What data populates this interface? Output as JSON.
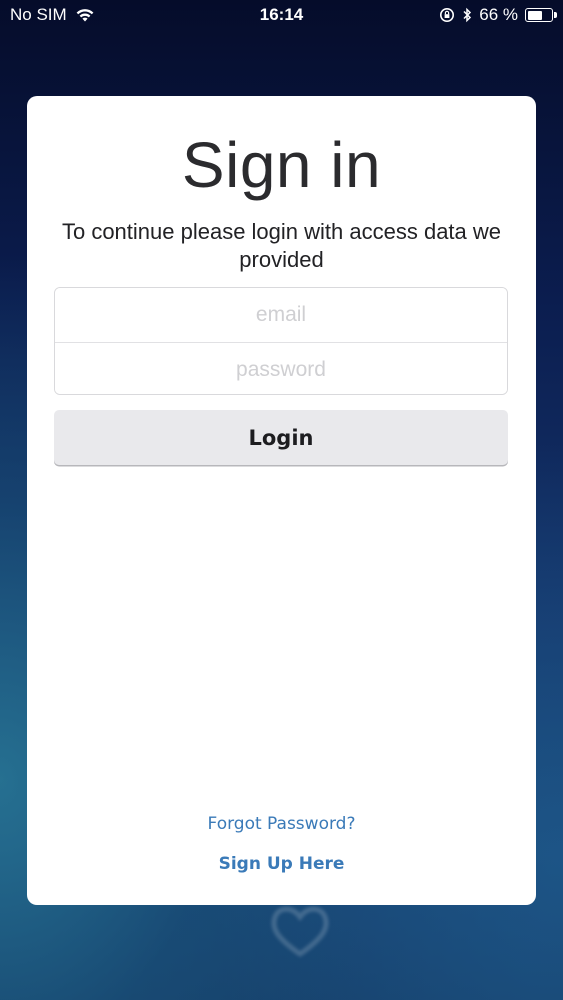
{
  "status_bar": {
    "carrier": "No SIM",
    "time": "16:14",
    "battery_percent": "66 %",
    "battery_level": 0.66,
    "icons": [
      "wifi-icon",
      "orientation-lock-icon",
      "bluetooth-icon",
      "battery-icon"
    ]
  },
  "signin": {
    "title": "Sign in",
    "subtitle": "To continue please login with access data we provided",
    "email_placeholder": "email",
    "password_placeholder": "password",
    "login_label": "Login",
    "forgot_label": "Forgot Password?",
    "signup_label": "Sign Up Here"
  },
  "colors": {
    "link": "#3a7ab8",
    "button_bg": "#e9e9ec",
    "card_bg": "#ffffff"
  }
}
